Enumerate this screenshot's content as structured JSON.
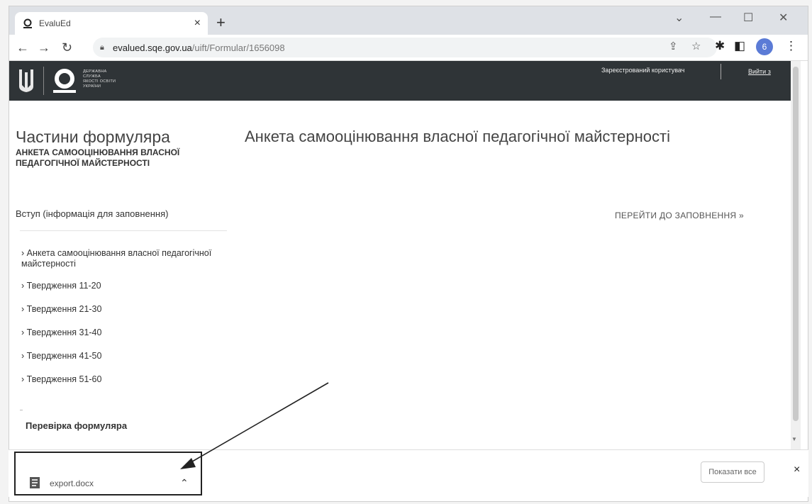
{
  "browser": {
    "tab_title": "EvaluEd",
    "tab_close": "×",
    "new_tab": "+",
    "url_host": "evalued.sqe.gov.ua",
    "url_path": "/uift/Formular/1656098",
    "profile_initial": "6"
  },
  "header": {
    "logo_text": [
      "ДЕРЖАВНА",
      "СЛУЖБА",
      "ЯКОСТІ ОСВІТИ",
      "УКРАЇНИ"
    ],
    "user_status": "Зареєстрований користувач",
    "login": "Вийти з"
  },
  "sidebar": {
    "title": "Частини формуляра",
    "subtitle": "АНКЕТА САМООЦІНЮВАННЯ ВЛАСНОЇ ПЕДАГОГІЧНОЇ МАЙСТЕРНОСТІ",
    "intro": "Вступ (інформація для заповнення)",
    "items": [
      "› Анкета самооцінювання власної педагогічної майстерності",
      "› Твердження 11-20",
      "› Твердження 21-30",
      "› Твердження 31-40",
      "› Твердження 41-50",
      "› Твердження 51-60"
    ],
    "check": "Перевірка формуляра"
  },
  "main": {
    "title": "Анкета самооцінювання власної педагогічної майстерності",
    "goto": "ПЕРЕЙТИ ДО ЗАПОВНЕННЯ »"
  },
  "downloads": {
    "file_name": "export.docx",
    "show_all": "Показати все",
    "close": "×"
  }
}
